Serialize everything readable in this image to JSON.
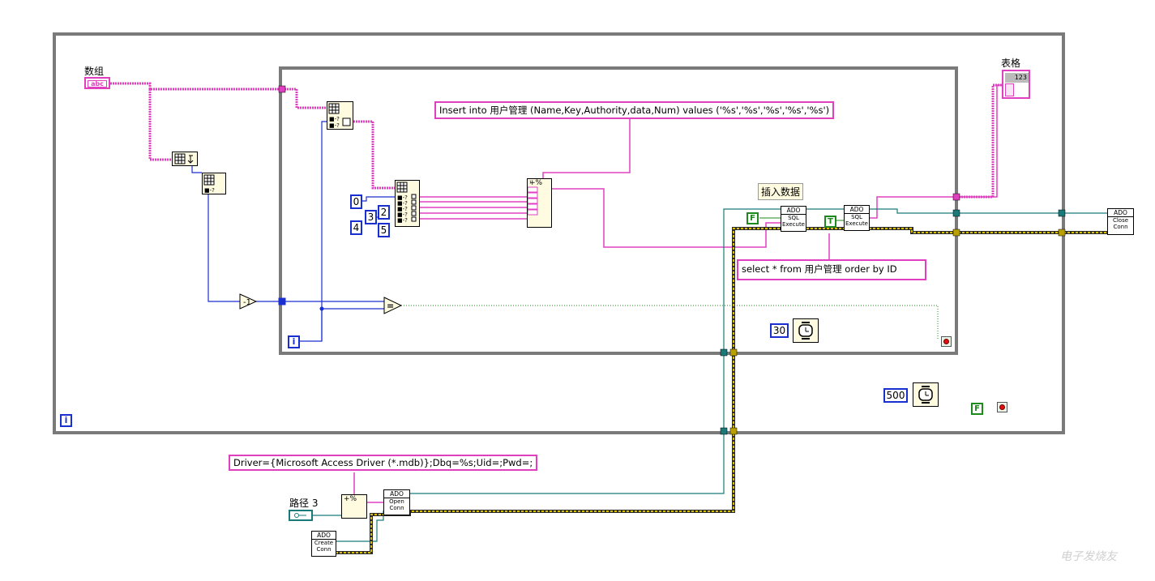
{
  "labels": {
    "array": "数组",
    "table": "表格",
    "insert_comment": "插入数据",
    "path": "路径 3"
  },
  "strings": {
    "insert_sql": "Insert into 用户管理 (Name,Key,Authority,data,Num) values ('%s','%s','%s','%s','%s')",
    "select_sql": "select * from 用户管理 order by ID",
    "conn_string": "Driver={Microsoft Access Driver (*.mdb)};Dbq=%s;Uid=;Pwd=;"
  },
  "constants": {
    "idx0": "0",
    "idx2": "2",
    "idx3": "3",
    "idx4": "4",
    "idx5": "5",
    "wait_inner": "30",
    "wait_outer": "500",
    "false1": "F",
    "true1": "T",
    "false2": "F",
    "iter": "i"
  },
  "ado": {
    "create": [
      "ADO",
      "Create",
      "Conn"
    ],
    "open": [
      "ADO",
      "Open",
      "Conn"
    ],
    "sql1": [
      "ADO",
      "SQL",
      "Execute"
    ],
    "sql2": [
      "ADO",
      "SQL",
      "Execute"
    ],
    "close": [
      "ADO",
      "Close",
      "Conn"
    ]
  },
  "glyphs": {
    "array_terminal": "abc",
    "table_terminal": "123",
    "format_header": "+%"
  },
  "watermark": "电子发烧友",
  "colors": {
    "string_wire": "#e040c0",
    "numeric_wire": "#1a2fd0",
    "refnum_wire": "#1a7a7a",
    "error_wire": "#b8a000",
    "structure_border": "#7a7a7a"
  }
}
